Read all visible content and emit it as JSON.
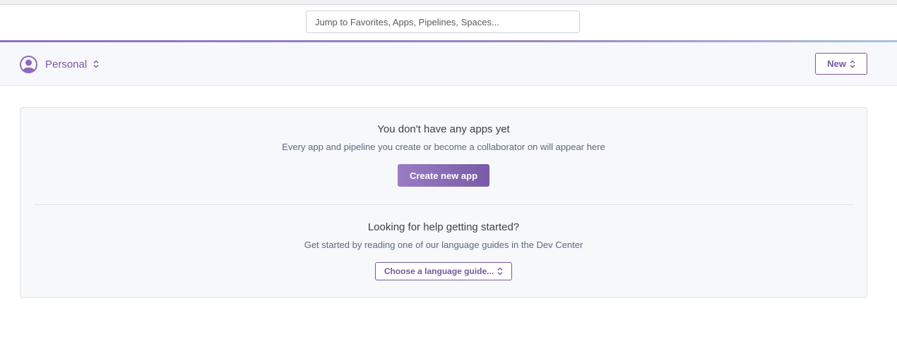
{
  "search": {
    "placeholder": "Jump to Favorites, Apps, Pipelines, Spaces..."
  },
  "subheader": {
    "account_label": "Personal",
    "new_button_label": "New"
  },
  "empty_state": {
    "title": "You don't have any apps yet",
    "description": "Every app and pipeline you create or become a collaborator on will appear here",
    "create_button_label": "Create new app"
  },
  "help": {
    "title": "Looking for help getting started?",
    "description": "Get started by reading one of our language guides in the Dev Center",
    "select_label": "Choose a language guide..."
  },
  "icons": {
    "avatar": "user-avatar-icon",
    "account_chevron": "chevron-up-down-icon",
    "new_chevron": "chevron-up-down-icon",
    "select_chevron": "chevron-up-down-icon"
  },
  "colors": {
    "brand": "#79589f",
    "accent_start": "#8f73bd",
    "accent_end": "#a9c3e6",
    "button_gradient_start": "#9a7cc6",
    "button_gradient_end": "#7a5aa6"
  }
}
